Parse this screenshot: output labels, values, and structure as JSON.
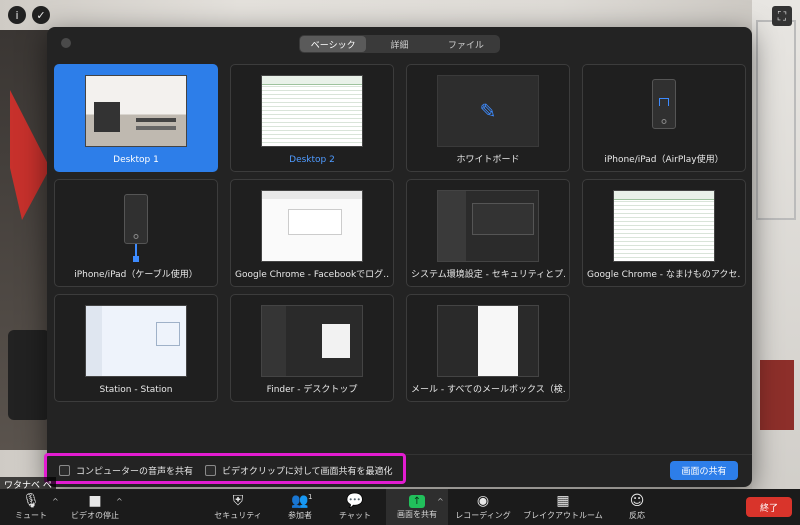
{
  "dialog": {
    "tabs": [
      {
        "label": "ベーシック",
        "active": true
      },
      {
        "label": "詳細",
        "active": false
      },
      {
        "label": "ファイル",
        "active": false
      }
    ],
    "tiles": [
      {
        "label": "Desktop 1",
        "selected": true,
        "thumb": "room"
      },
      {
        "label": "Desktop 2",
        "selected": false,
        "thumb": "sheet"
      },
      {
        "label": "ホワイトボード",
        "selected": false,
        "thumb": "whiteboard"
      },
      {
        "label": "iPhone/iPad（AirPlay使用）",
        "selected": false,
        "thumb": "airplay"
      },
      {
        "label": "iPhone/iPad（ケーブル使用）",
        "selected": false,
        "thumb": "cable"
      },
      {
        "label": "Google Chrome - Facebookでログ…",
        "selected": false,
        "thumb": "web"
      },
      {
        "label": "システム環境設定 - セキュリティとプ…",
        "selected": false,
        "thumb": "sys"
      },
      {
        "label": "Google Chrome - なまけものアクセ…",
        "selected": false,
        "thumb": "sheet"
      },
      {
        "label": "Station - Station",
        "selected": false,
        "thumb": "station"
      },
      {
        "label": "Finder - デスクトップ",
        "selected": false,
        "thumb": "finder"
      },
      {
        "label": "メール - すべてのメールボックス（検…",
        "selected": false,
        "thumb": "mail"
      }
    ],
    "options": {
      "share_sound": "コンピューターの音声を共有",
      "optimize_video": "ビデオクリップに対して画面共有を最適化"
    },
    "share_button": "画面の共有"
  },
  "name_tag": "ワタナベ ペ",
  "toolbar": {
    "mute": "ミュート",
    "stop_video": "ビデオの停止",
    "security": "セキュリティ",
    "participants": "参加者",
    "participants_count": "1",
    "chat": "チャット",
    "share_screen": "画面を共有",
    "recording": "レコーディング",
    "breakout": "ブレイクアウトルーム",
    "reactions": "反応",
    "end": "終了"
  },
  "colors": {
    "accent": "#2d7ee9",
    "highlight": "#e21cd1",
    "end": "#d9342b",
    "share_green": "#21c05b"
  }
}
